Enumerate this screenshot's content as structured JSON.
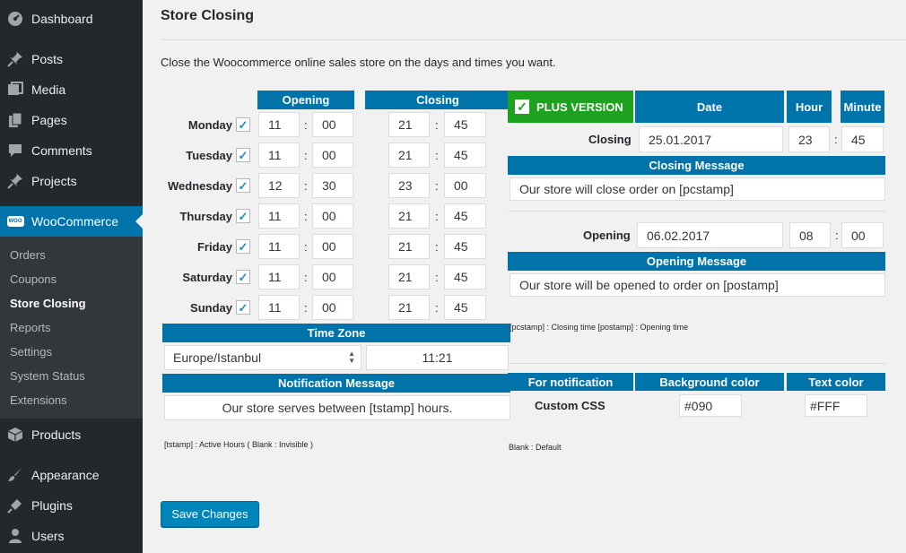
{
  "sidebar": {
    "items": [
      {
        "label": "Dashboard",
        "icon": "dashboard-icon"
      },
      {
        "label": "Posts",
        "icon": "pin-icon"
      },
      {
        "label": "Media",
        "icon": "media-icon"
      },
      {
        "label": "Pages",
        "icon": "pages-icon"
      },
      {
        "label": "Comments",
        "icon": "comments-icon"
      },
      {
        "label": "Projects",
        "icon": "pin-icon"
      },
      {
        "label": "WooCommerce",
        "icon": "woo-icon"
      },
      {
        "label": "Products",
        "icon": "products-icon"
      },
      {
        "label": "Appearance",
        "icon": "brush-icon"
      },
      {
        "label": "Plugins",
        "icon": "plugin-icon"
      },
      {
        "label": "Users",
        "icon": "users-icon"
      }
    ],
    "woo_badge": "WOO",
    "submenu": [
      "Orders",
      "Coupons",
      "Store Closing",
      "Reports",
      "Settings",
      "System Status",
      "Extensions"
    ]
  },
  "page": {
    "title": "Store Closing",
    "intro": "Close the Woocommerce online sales store on the days and times you want."
  },
  "schedule": {
    "opening_header": "Opening",
    "closing_header": "Closing",
    "colon": ":",
    "check": "✓",
    "days": [
      {
        "day": "Monday",
        "open_h": "11",
        "open_m": "00",
        "close_h": "21",
        "close_m": "45"
      },
      {
        "day": "Tuesday",
        "open_h": "11",
        "open_m": "00",
        "close_h": "21",
        "close_m": "45"
      },
      {
        "day": "Wednesday",
        "open_h": "12",
        "open_m": "30",
        "close_h": "23",
        "close_m": "00"
      },
      {
        "day": "Thursday",
        "open_h": "11",
        "open_m": "00",
        "close_h": "21",
        "close_m": "45"
      },
      {
        "day": "Friday",
        "open_h": "11",
        "open_m": "00",
        "close_h": "21",
        "close_m": "45"
      },
      {
        "day": "Saturday",
        "open_h": "11",
        "open_m": "00",
        "close_h": "21",
        "close_m": "45"
      },
      {
        "day": "Sunday",
        "open_h": "11",
        "open_m": "00",
        "close_h": "21",
        "close_m": "45"
      }
    ],
    "timezone_header": "Time Zone",
    "timezone": "Europe/Istanbul",
    "current_time": "11:21",
    "notification_header": "Notification Message",
    "notification_message": "Our store serves between [tstamp] hours.",
    "notification_hint": "[tstamp] : Active Hours ( Blank : Invisible )"
  },
  "plus": {
    "label": "PLUS VERSION",
    "date_header": "Date",
    "hour_header": "Hour",
    "minute_header": "Minute",
    "closing_label": "Closing",
    "closing_date": "25.01.2017",
    "closing_hour": "23",
    "closing_minute": "45",
    "closing_message_header": "Closing Message",
    "closing_message": "Our store will close order on [pcstamp]",
    "opening_label": "Opening",
    "opening_date": "06.02.2017",
    "opening_hour": "08",
    "opening_minute": "00",
    "opening_message_header": "Opening Message",
    "opening_message": "Our store will be opened to order on [postamp]",
    "stamp_hint": "[pcstamp] : Closing time [postamp] : Opening time",
    "for_notification_header": "For notification",
    "bg_color_header": "Background color",
    "text_color_header": "Text color",
    "custom_css_label": "Custom CSS",
    "bg_color": "#090",
    "text_color": "#FFF",
    "blank_hint": "Blank : Default"
  },
  "save_label": "Save Changes",
  "colors": {
    "sidebar": "#23282d",
    "accent": "#0073aa",
    "plus_green": "#1ea11e"
  }
}
